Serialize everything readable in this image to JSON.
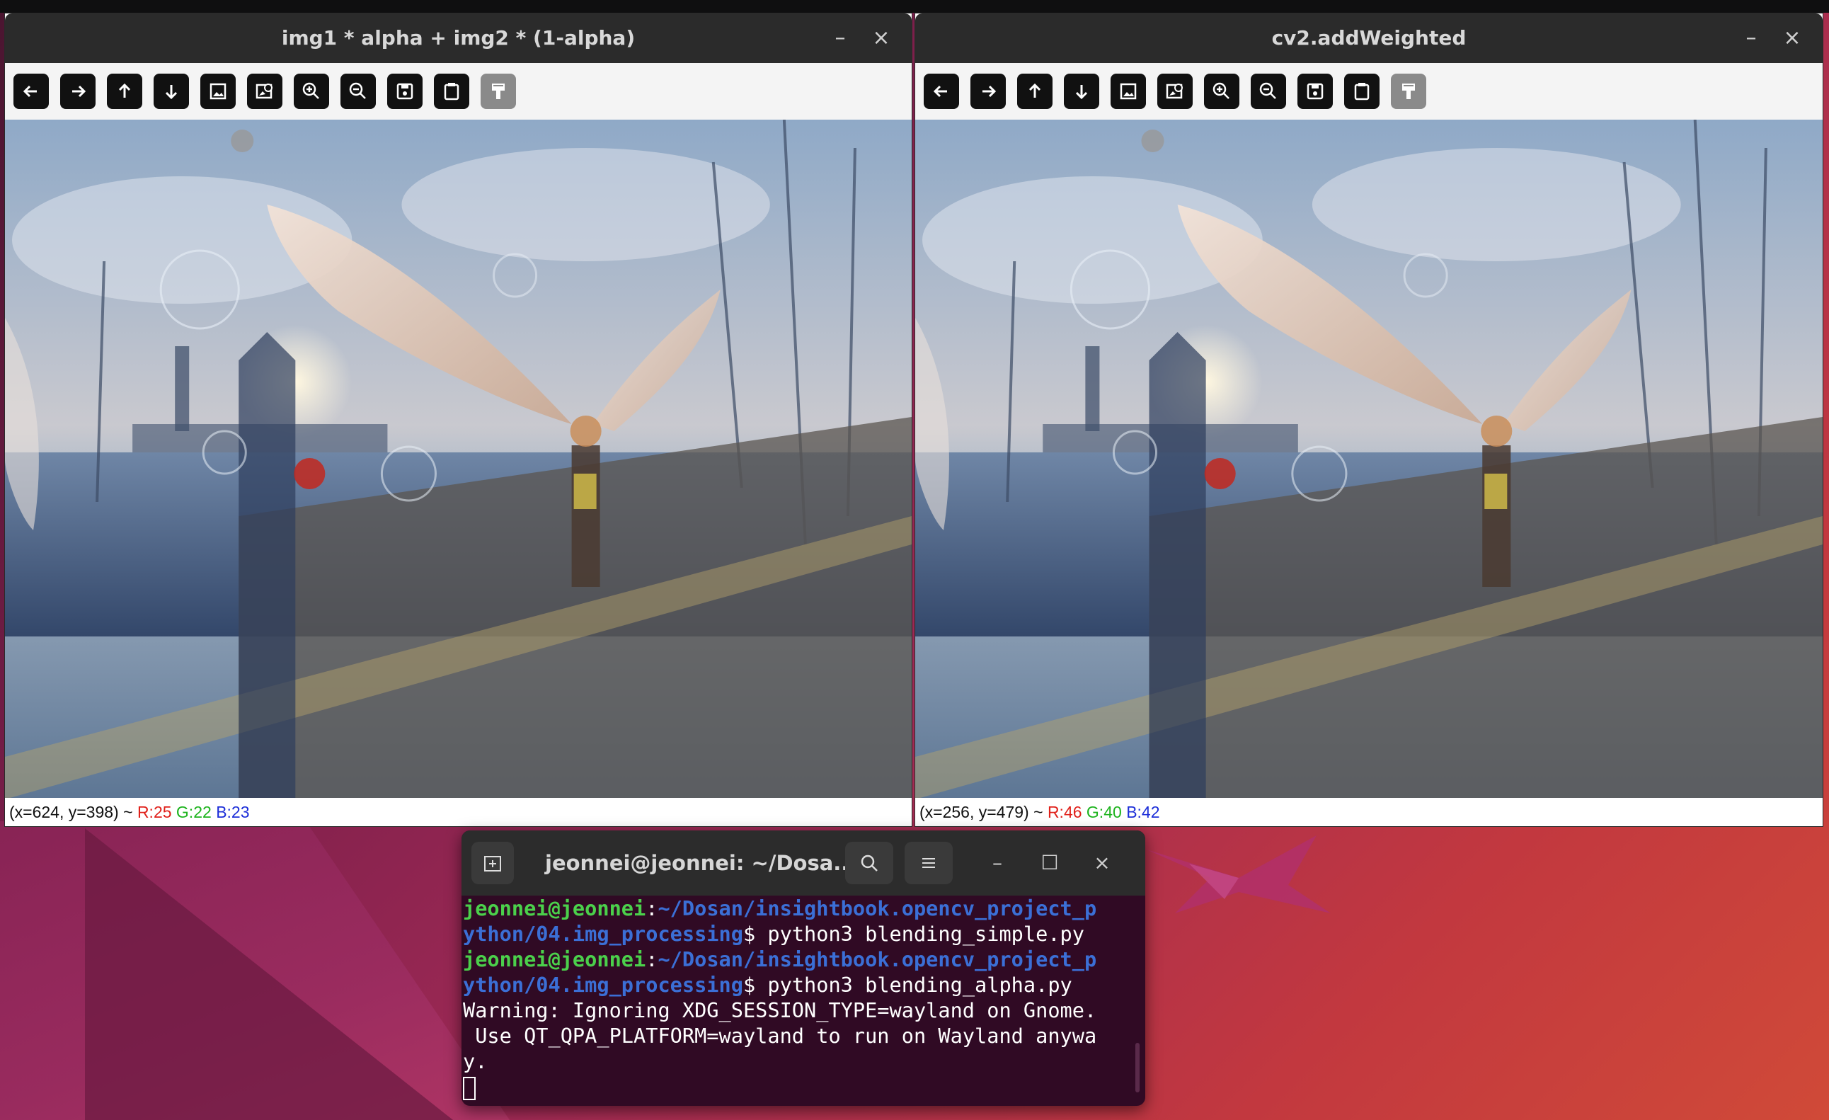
{
  "windows": [
    {
      "title": "img1 * alpha + img2 * (1-alpha)",
      "status": {
        "coords": "(x=624, y=398) ~ ",
        "r": "R:25",
        "g": "G:22",
        "b": "B:23"
      }
    },
    {
      "title": "cv2.addWeighted",
      "status": {
        "coords": "(x=256, y=479) ~ ",
        "r": "R:46",
        "g": "G:40",
        "b": "B:42"
      }
    }
  ],
  "window_controls": {
    "minimize": "–",
    "close": "×",
    "maximize": "☐"
  },
  "toolbar_icons": [
    "pan-left-icon",
    "pan-right-icon",
    "pan-up-icon",
    "pan-down-icon",
    "zoom-in-fit-icon",
    "zoom-original-icon",
    "zoom-in-icon",
    "zoom-out-icon",
    "save-icon",
    "copy-clipboard-icon",
    "properties-icon"
  ],
  "terminal": {
    "title": "jeonnei@jeonnei: ~/Dosa...",
    "lines": [
      {
        "user": "jeonnei@jeonnei",
        "sep": ":",
        "path": "~/Dosan/insightbook.opencv_project_p"
      },
      {
        "path": "ython/04.img_processing",
        "cmd": "$ python3 blending_simple.py"
      },
      {
        "user": "jeonnei@jeonnei",
        "sep": ":",
        "path": "~/Dosan/insightbook.opencv_project_p"
      },
      {
        "path": "ython/04.img_processing",
        "cmd": "$ python3 blending_alpha.py"
      },
      {
        "text": "Warning: Ignoring XDG_SESSION_TYPE=wayland on Gnome."
      },
      {
        "text": " Use QT_QPA_PLATFORM=wayland to run on Wayland anywa"
      },
      {
        "text": "y."
      }
    ]
  },
  "colors": {
    "terminal_bg": "#300a24",
    "prompt_user": "#4bd04b",
    "prompt_path": "#3b6fd6"
  }
}
